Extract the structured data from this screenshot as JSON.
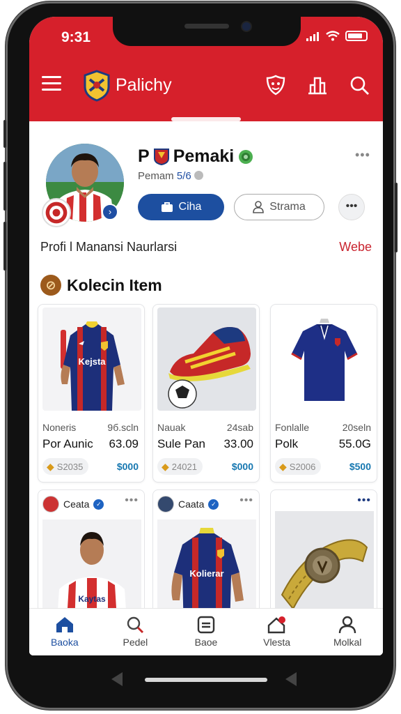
{
  "status": {
    "time": "9:31"
  },
  "appbar": {
    "title": "Palichy"
  },
  "profile": {
    "name": "Pemaki",
    "name_prefix": "P",
    "subtitle_a": "Pemam",
    "subtitle_b": "5/6",
    "primary_button": "Ciha",
    "secondary_button": "Strama",
    "info_line": "Profi l Manansi Naurlarsi",
    "web_link": "Webe"
  },
  "collection": {
    "title": "Kolecin Item",
    "items": [
      {
        "category": "Noneris",
        "sizes": "9б.scln",
        "name": "Por Aunic",
        "price": "63.09",
        "tag": "S2035",
        "value": "$000",
        "shirt_text": "Kejsta"
      },
      {
        "category": "Nauak",
        "sizes": "24sab",
        "name": "Sule Pan",
        "price": "33.00",
        "tag": "24021",
        "value": "$000"
      },
      {
        "category": "Fonlalle",
        "sizes": "20seln",
        "name": "Polk",
        "price": "55.0G",
        "tag": "S2006",
        "value": "$500"
      }
    ],
    "posts": [
      {
        "author": "Ceata",
        "shirt_text": "Kaytas"
      },
      {
        "author": "Caata",
        "shirt_text": "Kolierar"
      },
      {
        "author": ""
      }
    ]
  },
  "bottom_nav": [
    {
      "label": "Baoka",
      "icon": "home-icon",
      "active": true
    },
    {
      "label": "Pedel",
      "icon": "search-icon",
      "active": false
    },
    {
      "label": "Baoe",
      "icon": "card-icon",
      "active": false
    },
    {
      "label": "Vlesta",
      "icon": "notification-icon",
      "active": false
    },
    {
      "label": "Molkal",
      "icon": "person-icon",
      "active": false
    }
  ],
  "colors": {
    "brand_red": "#d6202b",
    "primary_blue": "#1d4fa0",
    "value_blue": "#1677b0",
    "web_red": "#c9242f"
  }
}
